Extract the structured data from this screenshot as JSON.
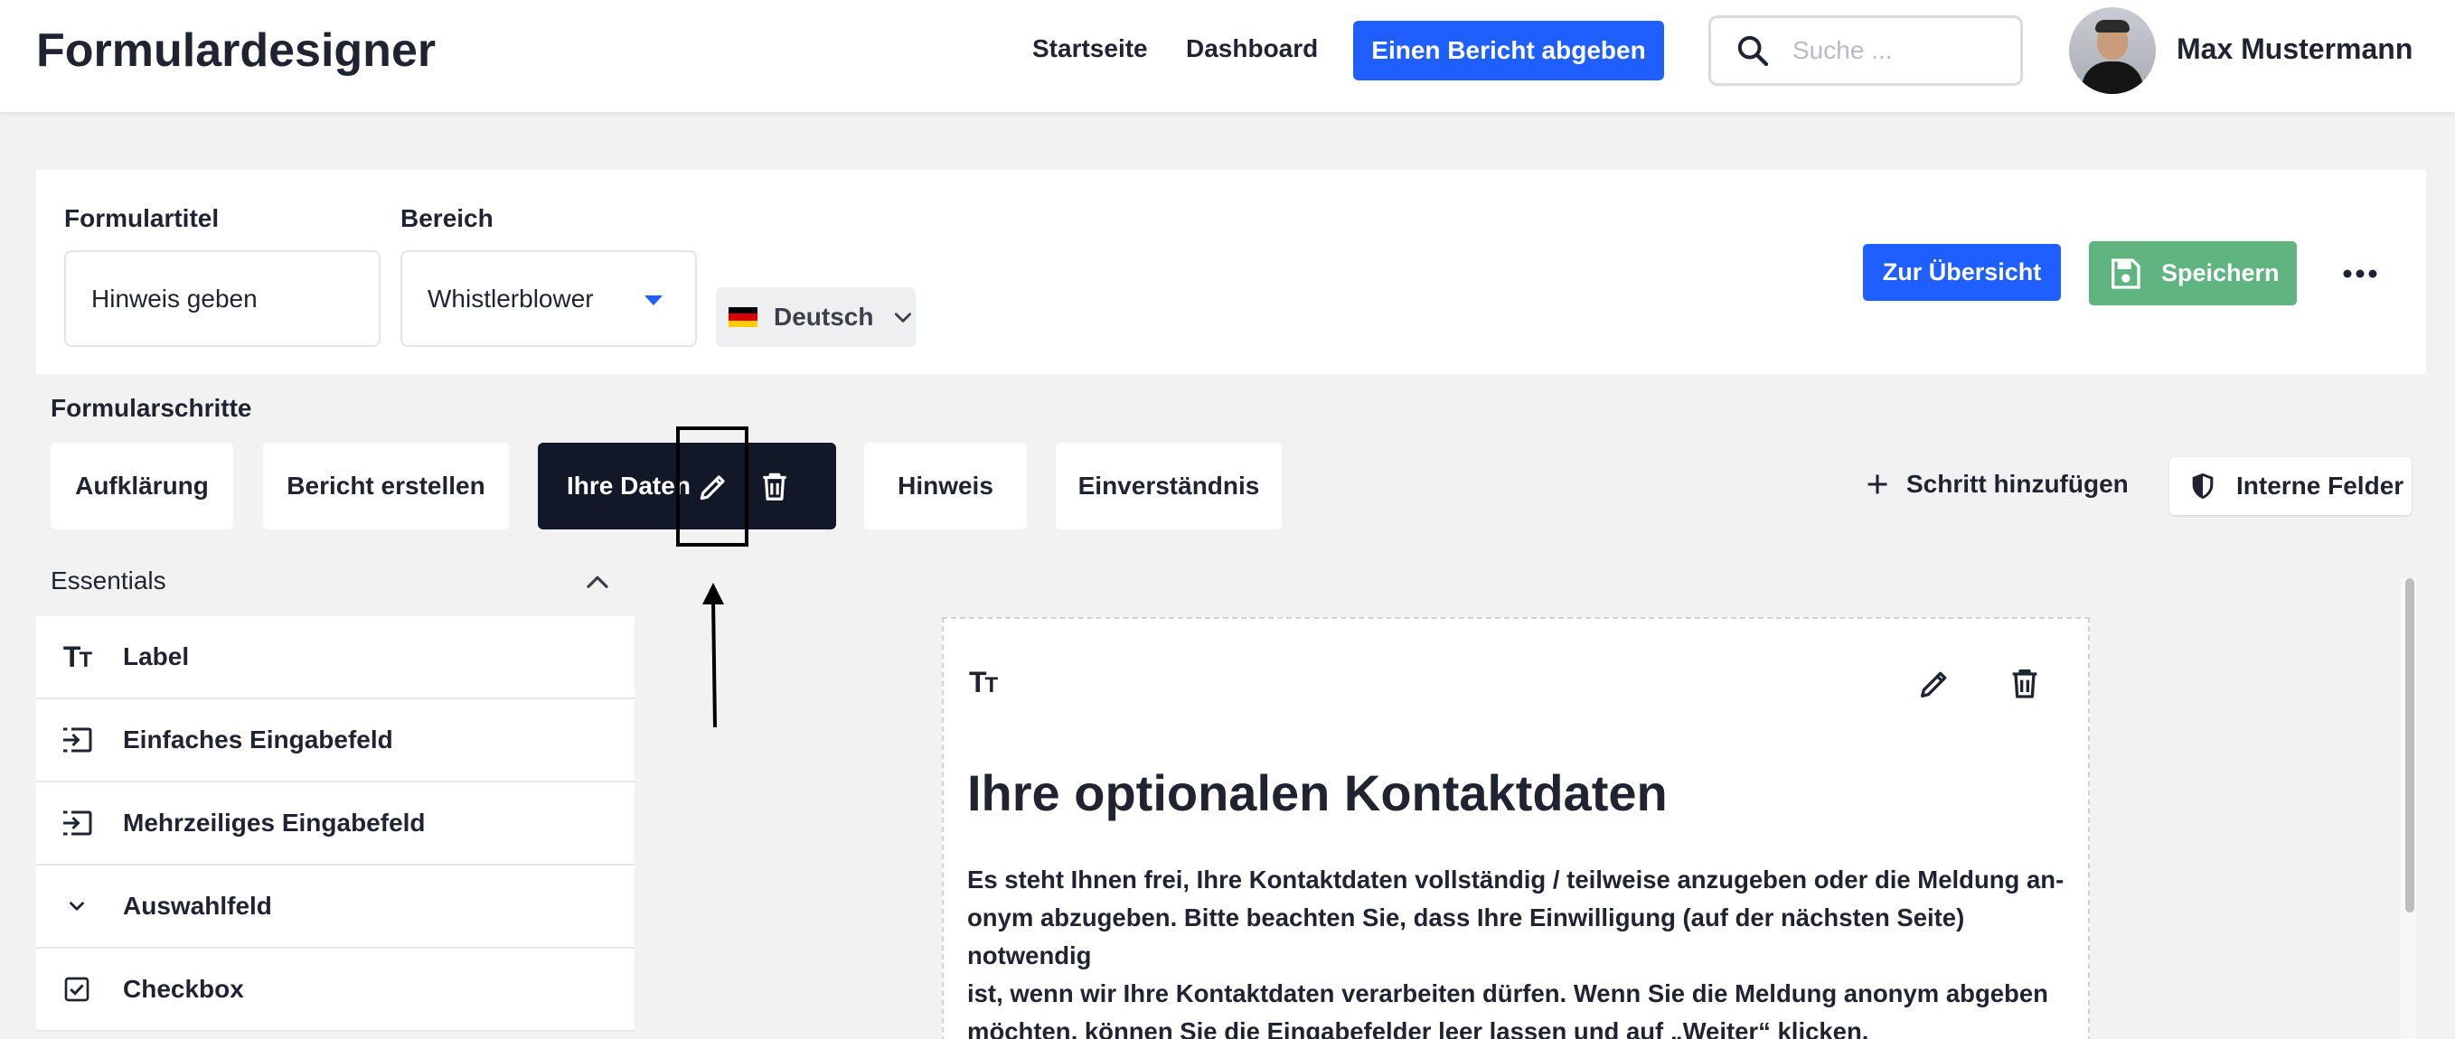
{
  "header": {
    "app_title": "Formulardesigner",
    "nav": {
      "home": "Startseite",
      "dashboard": "Dashboard"
    },
    "report_button": "Einen Bericht abgeben",
    "search_placeholder": "Suche ...",
    "user_name": "Max Mustermann"
  },
  "form": {
    "title_label": "Formulartitel",
    "title_value": "Hinweis geben",
    "area_label": "Bereich",
    "area_value": "Whistlerblower",
    "language": "Deutsch",
    "overview_button": "Zur Übersicht",
    "save_button": "Speichern"
  },
  "steps": {
    "title": "Formularschritte",
    "items": [
      {
        "label": "Aufklärung"
      },
      {
        "label": "Bericht erstellen"
      },
      {
        "label": "Ihre Daten",
        "active": true
      },
      {
        "label": "Hinweis"
      },
      {
        "label": "Einverständnis"
      }
    ],
    "add_step": "Schritt hinzufügen",
    "internal_fields": "Interne Felder"
  },
  "palette": {
    "section": "Essentials",
    "items": [
      {
        "label": "Label",
        "icon": "text-size-icon"
      },
      {
        "label": "Einfaches Eingabefeld",
        "icon": "input-icon"
      },
      {
        "label": "Mehrzeiliges Eingabefeld",
        "icon": "input-icon"
      },
      {
        "label": "Auswahlfeld",
        "icon": "chevron-down-icon"
      },
      {
        "label": "Checkbox",
        "icon": "checkbox-icon"
      }
    ]
  },
  "canvas": {
    "block_title": "Ihre optionalen Kontaktdaten",
    "block_lines": [
      "Es steht Ihnen frei, Ihre Kontaktdaten vollständig / teilweise anzugeben oder die Meldung an-",
      "onym abzugeben. Bitte beachten Sie, dass Ihre Einwilligung (auf der nächsten Seite) notwendig",
      "ist, wenn wir Ihre Kontaktdaten verarbeiten dürfen. Wenn Sie die Meldung anonym abgeben",
      "möchten, können Sie die Eingabefelder leer lassen und auf „Weiter“ klicken."
    ]
  },
  "colors": {
    "primary": "#1f5eff",
    "save": "#5fb47f",
    "active_step": "#121827",
    "flag_black": "#000000",
    "flag_red": "#dd0000",
    "flag_gold": "#ffce00"
  }
}
